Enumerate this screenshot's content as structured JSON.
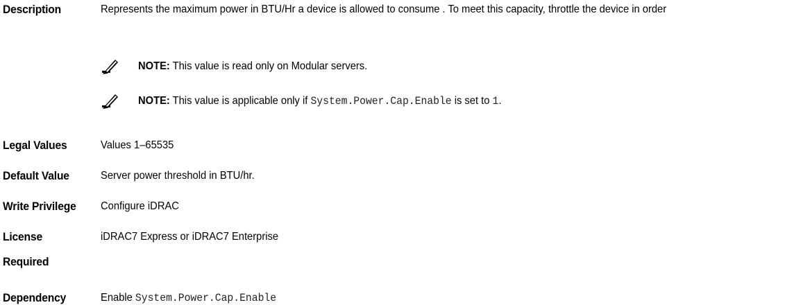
{
  "rows": {
    "description": {
      "label": "Description",
      "text": "Represents the maximum power in BTU/Hr a device is allowed to consume . To meet this capacity, throttle the device in order"
    },
    "notes": [
      {
        "lead": "NOTE:",
        "text_before": " This value is read only on Modular servers.",
        "code": "",
        "text_mid": "",
        "code2": "",
        "text_after": ""
      },
      {
        "lead": "NOTE:",
        "text_before": " This value is applicable only if ",
        "code": "System.Power.Cap.Enable",
        "text_mid": " is set to ",
        "code2": "1",
        "text_after": "."
      }
    ],
    "legal_values": {
      "label": "Legal Values",
      "value": "Values 1–65535"
    },
    "default_value": {
      "label": "Default Value",
      "value": "Server power threshold in BTU/hr."
    },
    "write_privilege": {
      "label": "Write Privilege",
      "value": "Configure iDRAC"
    },
    "license_required": {
      "label_line1": "License",
      "label_line2": "Required",
      "value": "iDRAC7 Express or iDRAC7 Enterprise"
    },
    "dependency": {
      "label": "Dependency",
      "value_prefix": "Enable ",
      "value_code": "System.Power.Cap.Enable"
    }
  },
  "icons": {
    "note": "pencil-note-icon"
  }
}
